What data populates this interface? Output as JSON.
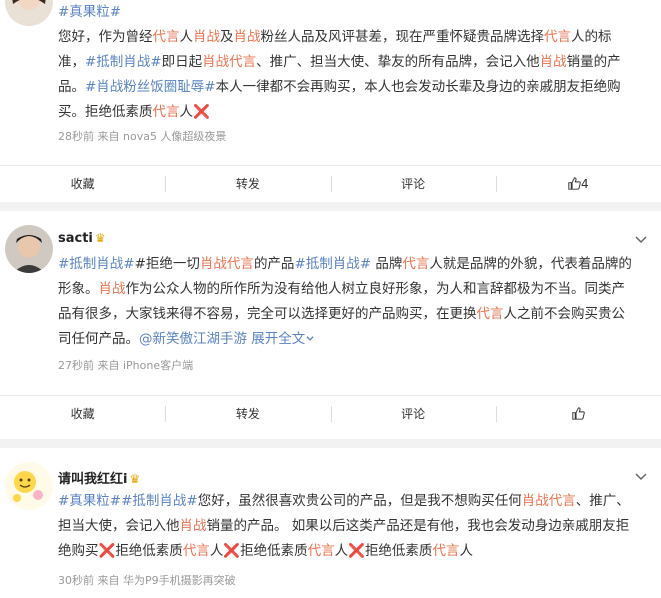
{
  "post1": {
    "hashtag_top": "#真果粒#",
    "lines": [
      [
        "您好，作为曾经",
        "代言",
        "人",
        "肖战",
        "及",
        "肖战",
        "粉丝人品及风评甚差，现在严重怀疑贵品牌选择",
        "代言",
        "人的标"
      ],
      [
        "准，",
        "#抵制肖战#",
        "即日起",
        "肖战代言",
        "、推广、担当大使、挚友的所有品牌，会记入他",
        "肖战",
        "销量的产"
      ],
      [
        "品。",
        "#肖战粉丝饭圈耻辱#",
        "本人一律都不会再购买，本人也会发动长辈及身边的亲戚朋友拒绝购"
      ],
      [
        "买。拒绝低素质",
        "代言",
        "人",
        "❌"
      ]
    ],
    "meta": "28秒前   来自 nova5 人像超级夜景",
    "actions": {
      "favorite": "收藏",
      "repost": "转发",
      "comment": "评论",
      "like_count": "4"
    }
  },
  "post2": {
    "username": "sacti",
    "crown": "♛",
    "lines": [
      [
        "#抵制肖战#",
        "#拒绝一切",
        "肖战代言",
        "的产品",
        "#抵制肖战#",
        " 品牌",
        "代言",
        "人就是品牌的外貌，代表着品牌的"
      ],
      [
        "形象。",
        "肖战",
        "作为公众人物的所作所为没有给他人树立良好形象，为人和言辞都极为不当。同类产"
      ],
      [
        "品有很多，大家钱来得不容易，完全可以选择更好的产品购买，在更换",
        "代言",
        "人之前不会购买贵公"
      ],
      [
        "司任何产品。",
        "@新笑傲江湖手游",
        "展开全文"
      ]
    ],
    "meta": "27秒前   来自 iPhone客户端",
    "actions": {
      "favorite": "收藏",
      "repost": "转发",
      "comment": "评论"
    }
  },
  "post3": {
    "username": "请叫我红红i",
    "crown": "♛",
    "lines": [
      [
        "#真果粒#",
        "#抵制肖战#",
        "您好，虽然很喜欢贵公司的产品，但是我不想购买任何",
        "肖战代言",
        "、推广、"
      ],
      [
        "担当大使，会记入他",
        "肖战",
        "销量的产品。 如果以后这类产品还是有他，我也会发动身边亲戚朋友拒"
      ],
      [
        "绝购买",
        "❌",
        "拒绝低素质",
        "代言",
        "人",
        "❌",
        "拒绝低素质",
        "代言",
        "人",
        "❌",
        "拒绝低素质",
        "代言",
        "人"
      ]
    ],
    "meta": "30秒前   来自 华为P9手机摄影再突破"
  },
  "colors": {
    "link": "#5a84c4",
    "keyword": "#eb7350",
    "cross": "#d6282e"
  }
}
